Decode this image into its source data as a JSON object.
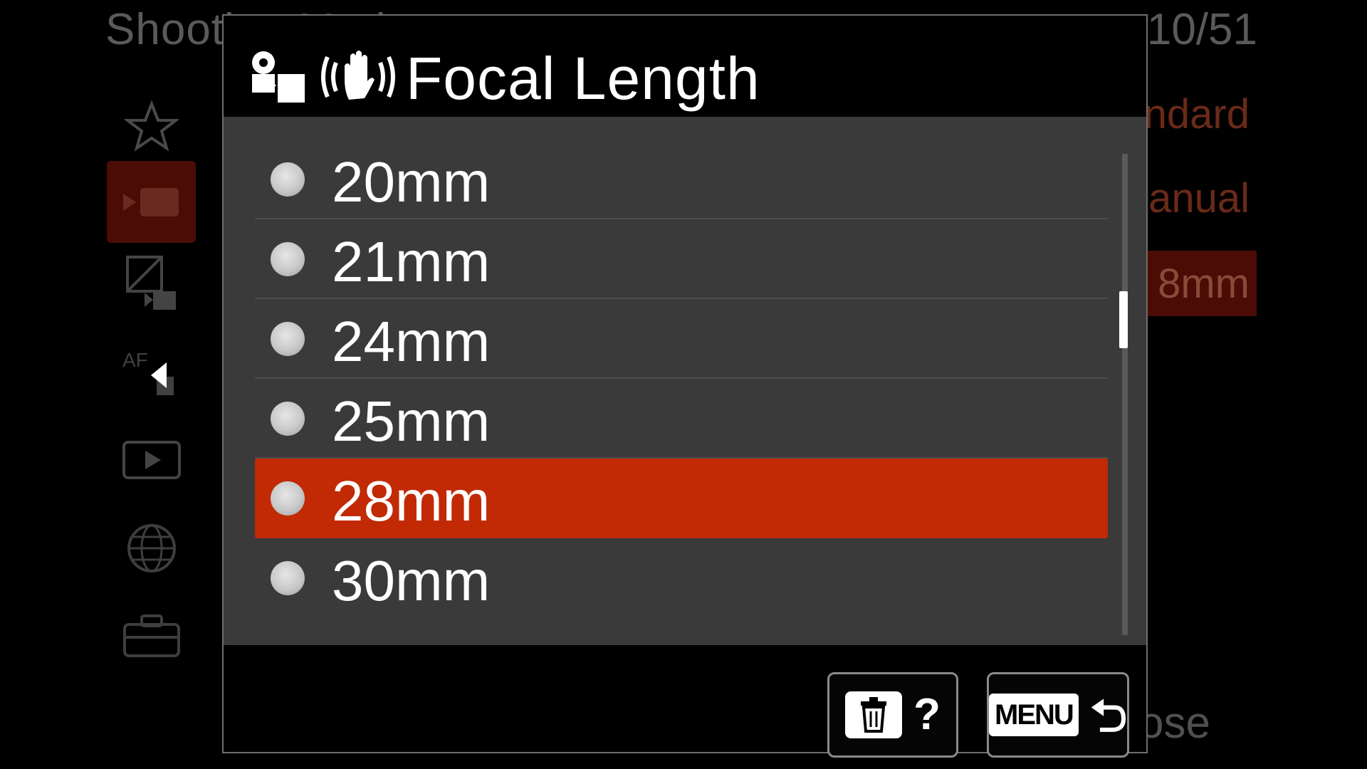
{
  "background": {
    "title": "Shooting Mode",
    "page": "10/51",
    "values": [
      "ndard",
      "anual",
      "8mm"
    ],
    "close_label": "ose",
    "sidebar_tabs": [
      "star-icon",
      "movie-camera-icon",
      "exposure-icon",
      "af-icon",
      "playback-icon",
      "network-icon",
      "toolbox-icon"
    ]
  },
  "dialog": {
    "title": "Focal Length",
    "options": [
      {
        "label": "20mm",
        "selected": false
      },
      {
        "label": "21mm",
        "selected": false
      },
      {
        "label": "24mm",
        "selected": false
      },
      {
        "label": "25mm",
        "selected": false
      },
      {
        "label": "28mm",
        "selected": true
      },
      {
        "label": "30mm",
        "selected": false
      }
    ],
    "footer": {
      "help_label": "?",
      "menu_key_label": "MENU"
    }
  },
  "colors": {
    "selected": "#c12a05",
    "list_bg": "#3a3a3a",
    "background": "#000000"
  }
}
